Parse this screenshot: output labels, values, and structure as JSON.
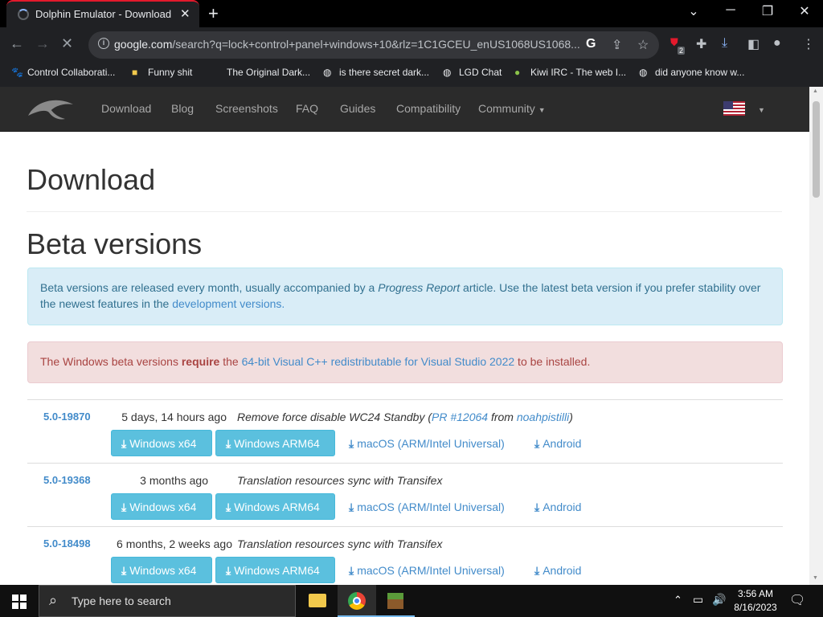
{
  "browser": {
    "tab_title": "Dolphin Emulator - Download",
    "url_domain": "google.com",
    "url_rest": "/search?q=lock+control+panel+windows+10&rlz=1C1GCEU_enUS1068US1068...",
    "ext_badge": "2",
    "bookmarks": [
      {
        "label": "Control Collaborati...",
        "icon": "paw-icon"
      },
      {
        "label": "Funny shit",
        "icon": "folder-icon"
      },
      {
        "label": "The Original Dark...",
        "icon": "blank-icon"
      },
      {
        "label": "is there secret dark...",
        "icon": "globe-icon"
      },
      {
        "label": "LGD Chat",
        "icon": "globe-icon"
      },
      {
        "label": "Kiwi IRC - The web I...",
        "icon": "kiwi-icon"
      },
      {
        "label": "did anyone know w...",
        "icon": "globe-icon"
      }
    ]
  },
  "site": {
    "nav": [
      "Download",
      "Blog",
      "Screenshots",
      "FAQ",
      "Guides",
      "Compatibility",
      "Community"
    ],
    "page_title": "Download",
    "section_title": "Beta versions",
    "info_text_1": "Beta versions are released every month, usually accompanied by a ",
    "info_em": "Progress Report",
    "info_text_2": " article. Use the latest beta version if you prefer stability over the newest features in the ",
    "info_link": "development versions.",
    "danger_text_1": "The Windows beta versions ",
    "danger_strong": "require",
    "danger_text_2": " the ",
    "danger_link": "64-bit Visual C++ redistributable for Visual Studio 2022",
    "danger_text_3": " to be installed.",
    "buttons": {
      "win_x64": "Windows x64",
      "win_arm": "Windows ARM64",
      "macos": "macOS (ARM/Intel Universal)",
      "android": "Android"
    },
    "releases": [
      {
        "version": "5.0-19870",
        "date": "5 days, 14 hours ago",
        "desc": "Remove force disable WC24 Standby",
        "pr_open": " (",
        "pr": "PR #12064",
        "from": " from ",
        "author": "noahpistilli",
        "pr_close": ")"
      },
      {
        "version": "5.0-19368",
        "date": "3 months ago",
        "desc": "Translation resources sync with Transifex"
      },
      {
        "version": "5.0-18498",
        "date": "6 months, 2 weeks ago",
        "desc": "Translation resources sync with Transifex"
      }
    ]
  },
  "taskbar": {
    "search_placeholder": "Type here to search",
    "time": "3:56 AM",
    "date": "8/16/2023"
  }
}
